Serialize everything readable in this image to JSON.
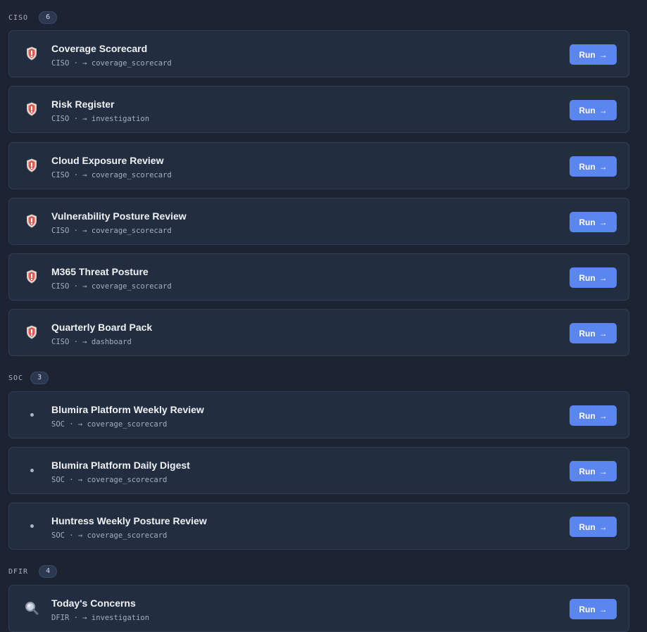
{
  "sections": [
    {
      "label": "CISO",
      "count": "6",
      "items": [
        {
          "title": "Coverage Scorecard",
          "subtitle": "CISO · → coverage_scorecard",
          "icon": "shield-icon"
        },
        {
          "title": "Risk Register",
          "subtitle": "CISO · → investigation",
          "icon": "shield-icon"
        },
        {
          "title": "Cloud Exposure Review",
          "subtitle": "CISO · → coverage_scorecard",
          "icon": "shield-icon"
        },
        {
          "title": "Vulnerability Posture Review",
          "subtitle": "CISO · → coverage_scorecard",
          "icon": "shield-icon"
        },
        {
          "title": "M365 Threat Posture",
          "subtitle": "CISO · → coverage_scorecard",
          "icon": "shield-icon"
        },
        {
          "title": "Quarterly Board Pack",
          "subtitle": "CISO · → dashboard",
          "icon": "shield-icon"
        }
      ]
    },
    {
      "label": "SOC",
      "count": "3",
      "items": [
        {
          "title": "Blumira Platform Weekly Review",
          "subtitle": "SOC · → coverage_scorecard",
          "icon": "dot-icon"
        },
        {
          "title": "Blumira Platform Daily Digest",
          "subtitle": "SOC · → coverage_scorecard",
          "icon": "dot-icon"
        },
        {
          "title": "Huntress Weekly Posture Review",
          "subtitle": "SOC · → coverage_scorecard",
          "icon": "dot-icon"
        }
      ]
    },
    {
      "label": "DFIR",
      "count": "4",
      "items": [
        {
          "title": "Today's Concerns",
          "subtitle": "DFIR · → investigation",
          "icon": "magnifier-icon"
        }
      ]
    }
  ],
  "run_label": "Run",
  "run_arrow": "→",
  "colors": {
    "accent": "#5b86f0",
    "shield": "#e05a4f"
  }
}
